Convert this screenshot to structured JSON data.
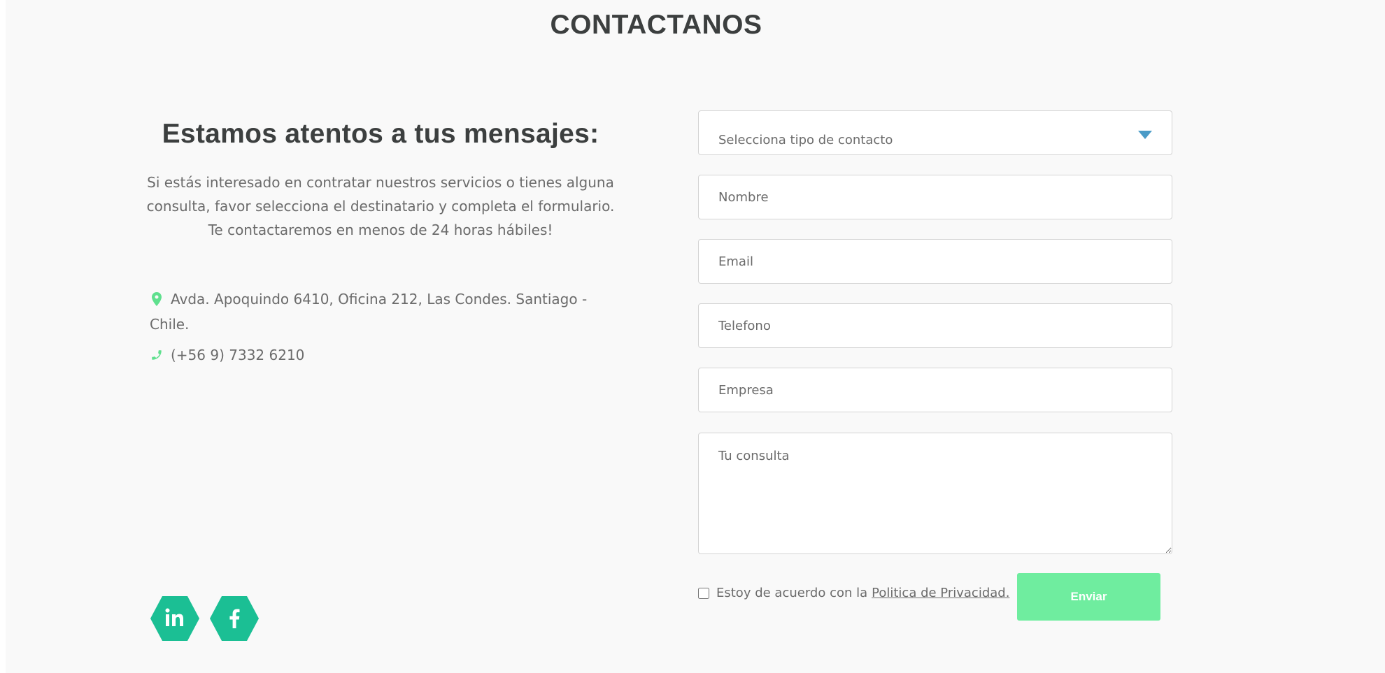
{
  "header": {
    "title": "CONTACTANOS"
  },
  "info_panel": {
    "heading": "Estamos atentos a tus mensajes:",
    "intro_line1": "Si estás interesado en contratar nuestros servicios o tienes alguna",
    "intro_line2": "consulta, favor selecciona el destinatario y completa el formulario.",
    "intro_line3": "Te contactaremos en menos de 24 horas hábiles!",
    "address_line1": "Avda. Apoquindo 6410, Oficina 212, Las Condes. Santiago -",
    "address_line2": "Chile.",
    "phone": "(+56 9) 7332 6210"
  },
  "social": {
    "items": [
      "linkedin-icon",
      "facebook-icon"
    ]
  },
  "form": {
    "contact_type_placeholder": "Selecciona tipo de contacto",
    "name_placeholder": "Nombre",
    "email_placeholder": "Email",
    "phone_placeholder": "Telefono",
    "company_placeholder": "Empresa",
    "message_placeholder": "Tu consulta",
    "consent_text": "Estoy de acuerdo con la",
    "privacy_link": "Politica de Privacidad.",
    "submit_label": "Enviar"
  },
  "colors": {
    "accent_green": "#6fed9f",
    "social_teal": "#1bbf94",
    "dropdown_arrow": "#4a9bc7",
    "icon_green": "#5fe08e",
    "text_dark": "#3c3f3f",
    "text_muted": "#6b6b6b",
    "background": "#f9f9f9"
  }
}
